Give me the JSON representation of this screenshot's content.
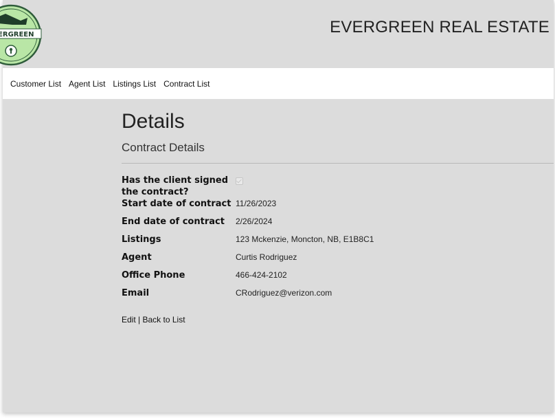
{
  "brand": {
    "title": "EVERGREEN REAL ESTATE",
    "logo_text": "EVERGREEN"
  },
  "nav": {
    "items": [
      "Customer List",
      "Agent List",
      "Listings List",
      "Contract List"
    ]
  },
  "page": {
    "title": "Details",
    "subtitle": "Contract Details"
  },
  "details": {
    "signed_label_line1": "Has the client signed",
    "signed_label_line2": "the contract?",
    "signed_value": true,
    "start_label": "Start date of contract",
    "start_value": "11/26/2023",
    "end_label": "End date of contract",
    "end_value": "2/26/2024",
    "listings_label": "Listings",
    "listings_value": "123 Mckenzie, Moncton, NB, E1B8C1",
    "agent_label": "Agent",
    "agent_value": "Curtis Rodriguez",
    "phone_label": "Office Phone",
    "phone_value": "466-424-2102",
    "email_label": "Email",
    "email_value": "CRodriguez@verizon.com"
  },
  "actions": {
    "edit": "Edit",
    "separator": "|",
    "back": "Back to List"
  },
  "colors": {
    "background": "#dcdcdc",
    "nav_bg": "#ffffff",
    "logo_green": "#b9e6a6",
    "logo_dark": "#2e5b3a"
  }
}
